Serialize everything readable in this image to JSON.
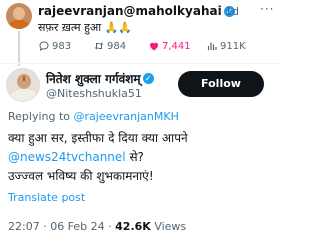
{
  "parent_tweet": {
    "author_handle": "rajeevranjan@maholkyahai",
    "time": "· 1d",
    "more": "···",
    "text": "सफ़र ख़त्म हुआ 🙏🙏",
    "replies": "983",
    "reposts": "984",
    "likes": "7,441",
    "views": "911K"
  },
  "main_tweet": {
    "display_name": "नितेश शुक्ला गर्गवंशम्",
    "handle": "@Niteshshukla51",
    "follow_label": "Follow",
    "replying_prefix": "Replying to ",
    "replying_to": "@rajeevranjanMKH",
    "line1": "क्या हुआ सर, इस्तीफा दे दिया क्या आपने",
    "mention": "@news24tvchannel",
    "line2_suffix": " से?",
    "line3": "उज्ज्वल भविष्य की शुभकामनाएं!",
    "translate": "Translate post",
    "timestamp": "22:07 · 06 Feb 24 · ",
    "views_count": "42.6K",
    "views_label": " Views"
  },
  "colors": {
    "accent": "#1d9bf0",
    "like": "#f91880",
    "muted": "#536471"
  }
}
